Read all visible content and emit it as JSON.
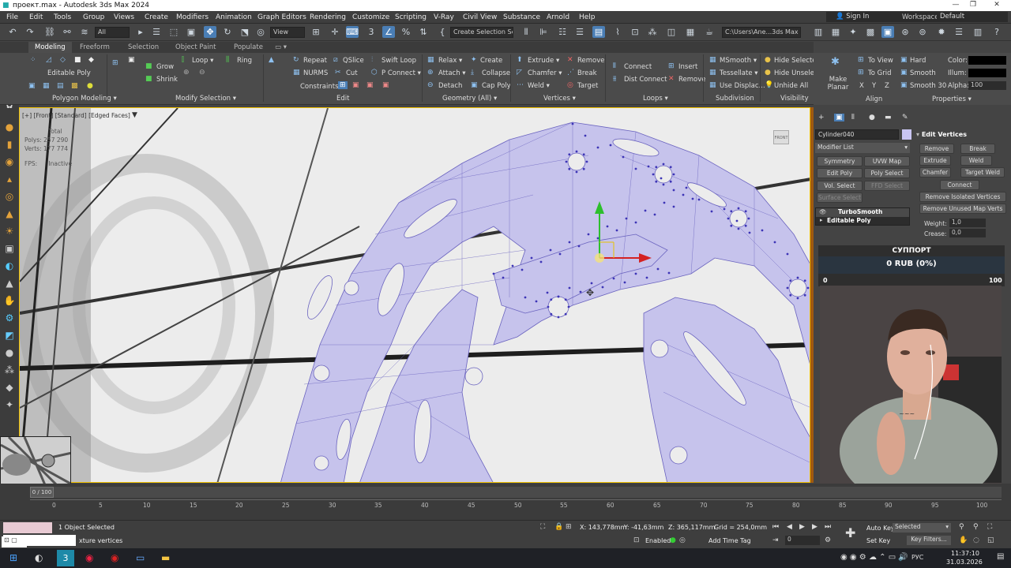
{
  "titlebar": {
    "title": "проект.max - Autodesk 3ds Max 2024",
    "min": "—",
    "max": "❐",
    "close": "✕"
  },
  "menu": [
    "File",
    "Edit",
    "Tools",
    "Group",
    "Views",
    "Create",
    "Modifiers",
    "Animation",
    "Graph Editors",
    "Rendering",
    "Customize",
    "Scripting",
    "V-Ray",
    "Civil View",
    "Substance",
    "Arnold",
    "Help"
  ],
  "signin": "Sign In",
  "workspaces": {
    "label": "Workspaces:",
    "value": "Default"
  },
  "toolbar": {
    "selection_filter": "All",
    "view": "View",
    "selection_set": "Create Selection Se",
    "path": "C:\\Users\\Ane...3ds Max 2024"
  },
  "ribbon_tabs": [
    "Modeling",
    "Freeform",
    "Selection",
    "Object Paint",
    "Populate"
  ],
  "ribbon": {
    "editable_poly": "Editable Poly",
    "grow": "Grow",
    "shrink": "Shrink",
    "loop": "Loop",
    "ring": "Ring",
    "repeat": "Repeat",
    "qslice": "QSlice",
    "swift_loop": "Swift Loop",
    "nurms": "NURMS",
    "cut": "Cut",
    "p_connect": "P Connect",
    "constraints": "Constraints:",
    "relax": "Relax",
    "create": "Create",
    "attach": "Attach",
    "collapse": "Collapse",
    "detach": "Detach",
    "cap_poly": "Cap Poly",
    "extrude": "Extrude",
    "remove": "Remove",
    "chamfer": "Chamfer",
    "break": "Break",
    "weld": "Weld",
    "target": "Target",
    "connect": "Connect",
    "dist_connect": "Dist Connect",
    "insert": "Insert",
    "remove2": "Remove",
    "msmooth": "MSmooth",
    "tessellate": "Tessellate",
    "use_displac": "Use Displac...",
    "hide_selected": "Hide Selected",
    "hide_unselected": "Hide Unselected",
    "unhide_all": "Unhide All",
    "make_planar": "Make Planar",
    "to_view": "To View",
    "to_grid": "To Grid",
    "x": "X",
    "y": "Y",
    "z": "Z",
    "hard": "Hard",
    "smooth": "Smooth",
    "smooth30": "Smooth 30",
    "color": "Color:",
    "illum": "Illum:",
    "alpha": "Alpha:",
    "alpha_val": "100",
    "groups": [
      "Polygon Modeling",
      "Modify Selection",
      "Edit",
      "Geometry (All)",
      "Vertices",
      "Loops",
      "Subdivision",
      "Visibility",
      "Align",
      "Properties"
    ]
  },
  "viewport": {
    "label": "[+] [Front] [Standard] [Edged Faces]",
    "stats_total": "Total",
    "polys": "Polys: 257 290",
    "verts": "Verts: 177 774",
    "fps": "FPS:",
    "fps_val": "Inactive",
    "viewcube": "FRONT"
  },
  "cmdpanel": {
    "object_name": "Cylinder040",
    "modifier_list": "Modifier List",
    "buttons": [
      "Symmetry",
      "UVW Map",
      "Edit Poly",
      "Poly Select",
      "Vol. Select",
      "FFD Select",
      "Surface Select"
    ],
    "stack": [
      "TurboSmooth",
      "Editable Poly"
    ],
    "rollout_title": "Edit Vertices",
    "remove": "Remove",
    "break": "Break",
    "extrude": "Extrude",
    "weld": "Weld",
    "chamfer": "Chamfer",
    "target_weld": "Target Weld",
    "connect": "Connect",
    "remove_isolated": "Remove Isolated Vertices",
    "remove_unused": "Remove Unused Map Verts",
    "weight_label": "Weight:",
    "weight_val": "1,0",
    "crease_label": "Crease:",
    "crease_val": "0,0"
  },
  "donation": {
    "title": "СУППОРТ",
    "amount": "0 RUB (0%)",
    "min": "0",
    "max": "100"
  },
  "timeline": {
    "ticks": [
      "0",
      "5",
      "10",
      "15",
      "20",
      "25",
      "30",
      "35",
      "40",
      "45",
      "50",
      "55",
      "60",
      "65",
      "70",
      "75",
      "80",
      "85",
      "90",
      "95",
      "100"
    ],
    "frame": "0 / 100"
  },
  "status": {
    "selected": "1 Object Selected",
    "prompt": "xture vertices",
    "x": "X: 143,778mm",
    "y": "Y: -41,63mm",
    "z": "Z: 365,117mm",
    "grid": "Grid = 254,0mm",
    "enabled": "Enabled:",
    "add_time_tag": "Add Time Tag",
    "auto_key": "Auto Key",
    "set_key": "Set Key",
    "selected_dd": "Selected",
    "key_filters": "Key Filters...",
    "frame_val": "0"
  },
  "taskbar": {
    "time": "11:37:10",
    "date": "31.03.2026",
    "lang": "РУС"
  },
  "colors": {
    "mesh": "#c6c3ec",
    "wire": "#6a63bf",
    "accent": "#4a7eb5",
    "selection": "#f2c200"
  }
}
